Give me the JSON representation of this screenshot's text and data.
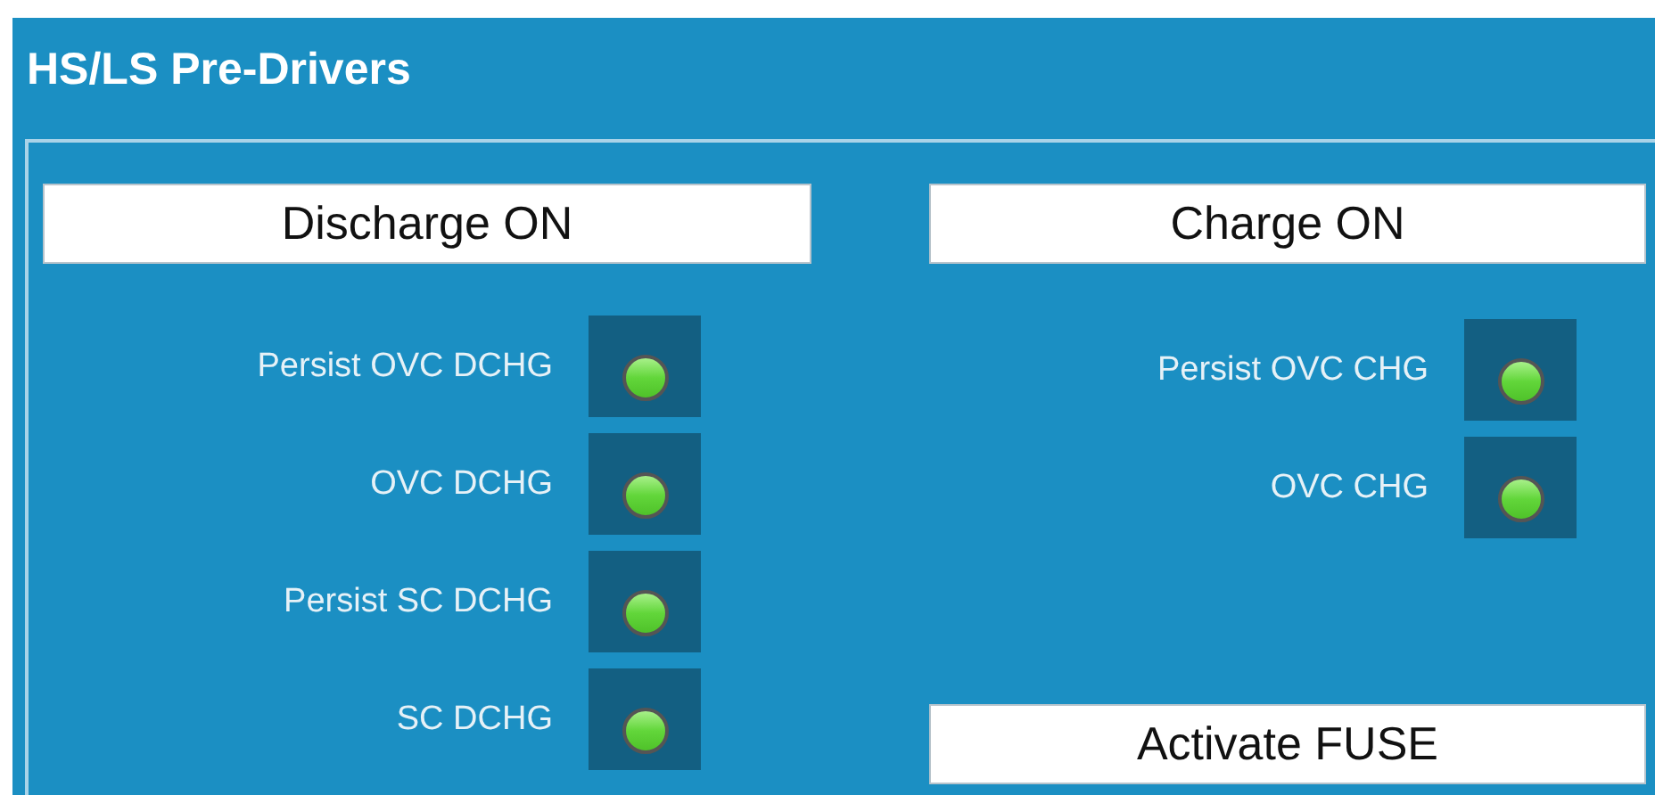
{
  "panel": {
    "title": "HS/LS Pre-Drivers"
  },
  "columns": [
    {
      "button": "Discharge ON",
      "indicators": [
        {
          "label": "Persist OVC DCHG",
          "on": true
        },
        {
          "label": "OVC DCHG",
          "on": true
        },
        {
          "label": "Persist SC DCHG",
          "on": true
        },
        {
          "label": "SC DCHG",
          "on": true
        }
      ]
    },
    {
      "button": "Charge ON",
      "indicators": [
        {
          "label": "Persist OVC CHG",
          "on": true
        },
        {
          "label": "OVC CHG",
          "on": true
        }
      ],
      "footer_button": "Activate FUSE"
    }
  ]
}
